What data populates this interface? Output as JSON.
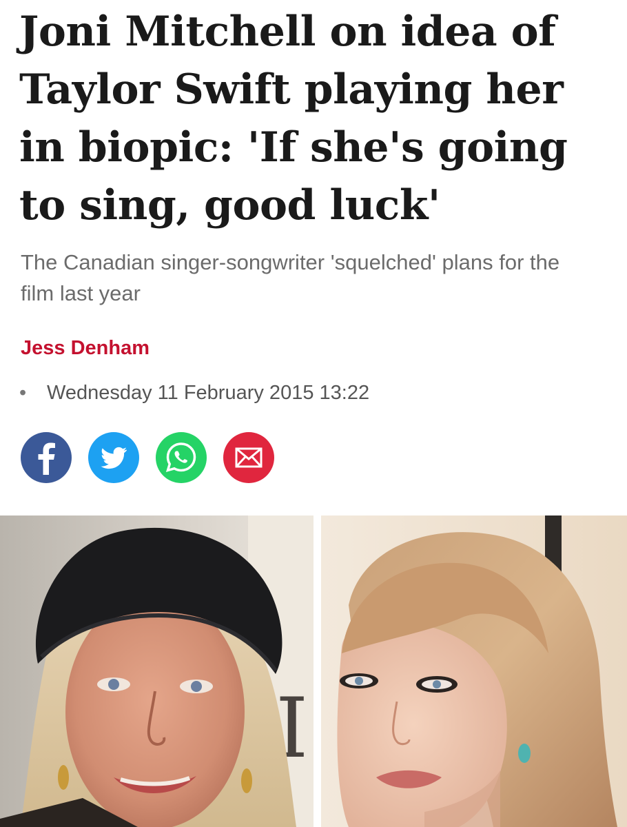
{
  "article": {
    "headline": "Joni Mitchell on idea of Taylor Swift playing her in biopic: 'If she's going to sing, good luck'",
    "subheading": "The Canadian singer-songwriter 'squelched' plans for the film last year",
    "author": "Jess Denham",
    "date": "Wednesday 11 February 2015 13:22"
  },
  "share": {
    "buttons": [
      {
        "name": "facebook",
        "icon": "facebook-icon",
        "color": "#3b5998"
      },
      {
        "name": "twitter",
        "icon": "twitter-icon",
        "color": "#1da1f2"
      },
      {
        "name": "whatsapp",
        "icon": "whatsapp-icon",
        "color": "#25d366"
      },
      {
        "name": "email",
        "icon": "email-icon",
        "color": "#e0263e"
      }
    ]
  },
  "colors": {
    "author": "#c4112f",
    "headline": "#1a1a1a",
    "subheading": "#6b6b6b"
  }
}
